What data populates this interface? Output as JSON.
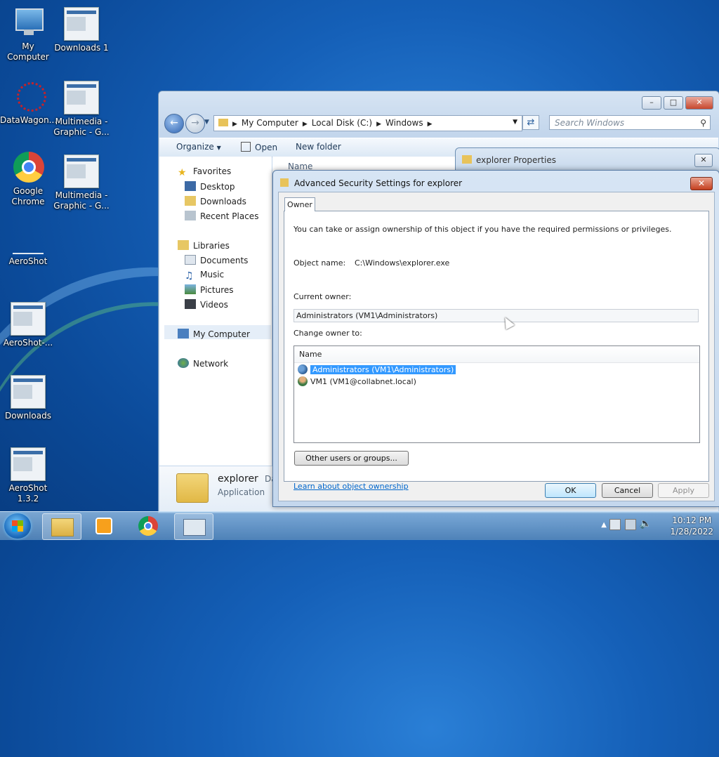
{
  "desktop": {
    "icons": [
      {
        "label": "My Computer"
      },
      {
        "label": "Downloads 1"
      },
      {
        "label": "DataWagon..."
      },
      {
        "label": "Multimedia - Graphic - G..."
      },
      {
        "label": "Google Chrome"
      },
      {
        "label": "Multimedia - Graphic - G..."
      },
      {
        "label": "AeroShot"
      },
      {
        "label": "AeroShot-..."
      },
      {
        "label": "Downloads"
      },
      {
        "label": "AeroShot 1.3.2"
      }
    ]
  },
  "explorer": {
    "breadcrumbs": [
      "My Computer",
      "Local Disk (C:)",
      "Windows"
    ],
    "search_placeholder": "Search Windows",
    "toolbar": {
      "organize": "Organize",
      "open": "Open",
      "new_folder": "New folder"
    },
    "column_name": "Name",
    "nav": {
      "favorites": "Favorites",
      "desktop": "Desktop",
      "downloads": "Downloads",
      "recent": "Recent Places",
      "libraries": "Libraries",
      "documents": "Documents",
      "music": "Music",
      "pictures": "Pictures",
      "videos": "Videos",
      "my_computer": "My Computer",
      "network": "Network"
    },
    "details": {
      "name": "explorer",
      "type": "Application",
      "extra": "Da"
    }
  },
  "properties": {
    "title": "explorer Properties"
  },
  "dialog": {
    "title": "Advanced Security Settings for explorer",
    "tab": "Owner",
    "intro": "You can take or assign ownership of this object if you have the required permissions or privileges.",
    "object_name_label": "Object name:",
    "object_name_value": "C:\\Windows\\explorer.exe",
    "current_owner_label": "Current owner:",
    "current_owner_value": "Administrators (VM1\\Administrators)",
    "change_owner_label": "Change owner to:",
    "list_header": "Name",
    "list_items": [
      "Administrators (VM1\\Administrators)",
      "VM1 (VM1@collabnet.local)"
    ],
    "other_users_button": "Other users or groups...",
    "learn_link": "Learn about object ownership",
    "ok": "OK",
    "cancel": "Cancel",
    "apply": "Apply"
  },
  "taskbar": {
    "time": "10:12 PM",
    "date": "1/28/2022"
  },
  "colors": {
    "selection": "#3399ff",
    "link": "#0066cc",
    "close_button": "#c7472d"
  }
}
